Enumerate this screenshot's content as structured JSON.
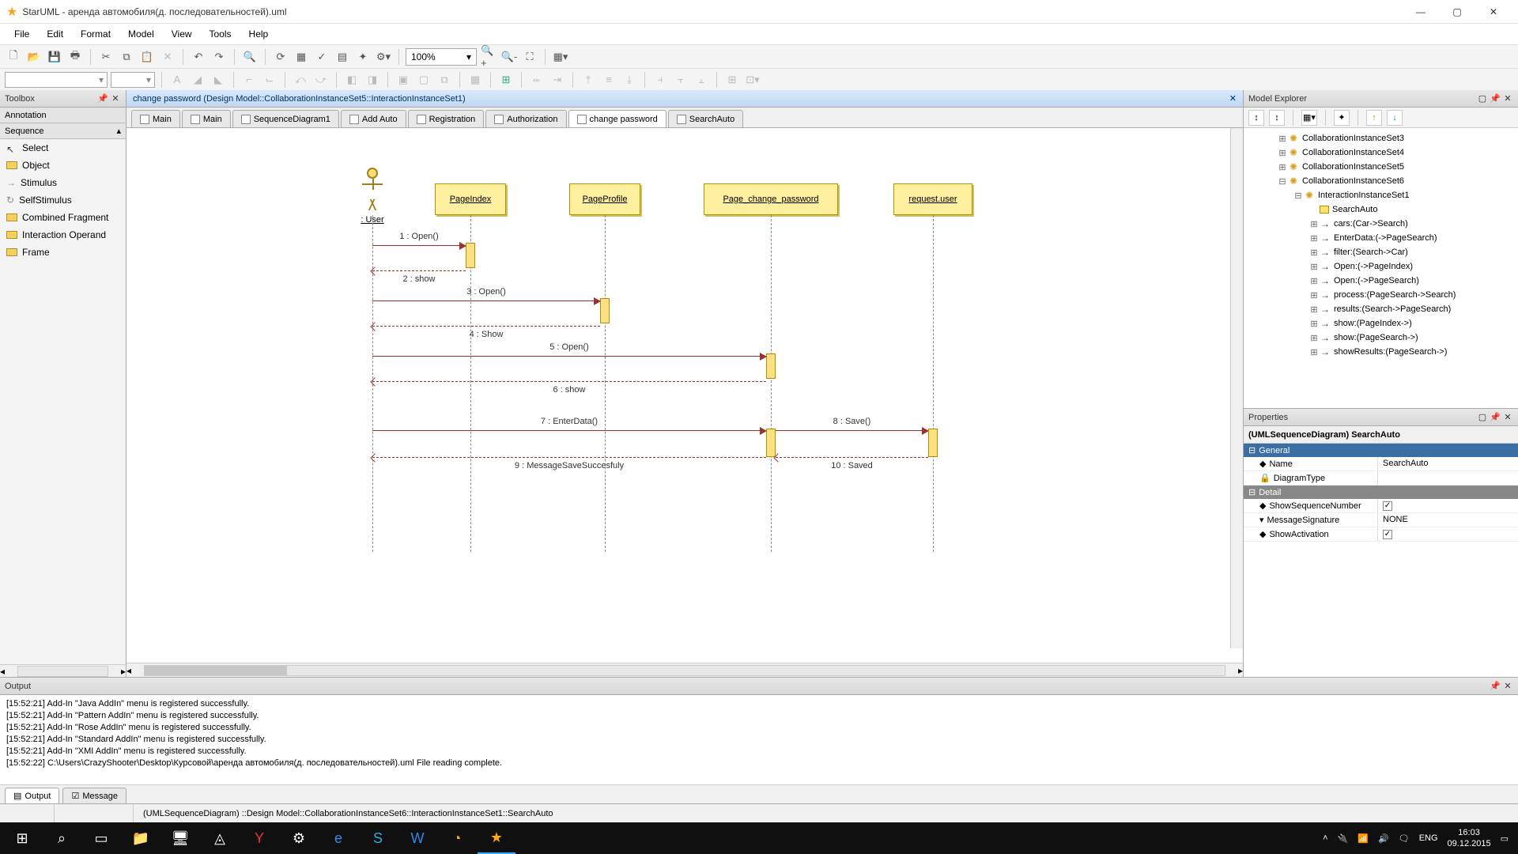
{
  "window": {
    "app": "StarUML",
    "title": "StarUML - аренда автомобиля(д. последовательностей).uml"
  },
  "menu": [
    "File",
    "Edit",
    "Format",
    "Model",
    "View",
    "Tools",
    "Help"
  ],
  "zoom": "100%",
  "toolbox": {
    "title": "Toolbox",
    "sections": {
      "annotation": "Annotation",
      "sequence": "Sequence"
    },
    "items": [
      "Select",
      "Object",
      "Stimulus",
      "SelfStimulus",
      "Combined Fragment",
      "Interaction Operand",
      "Frame"
    ]
  },
  "doc_path": "change password (Design Model::CollaborationInstanceSet5::InteractionInstanceSet1)",
  "tabs": [
    "Main",
    "Main",
    "SequenceDiagram1",
    "Add Auto",
    "Registration",
    "Authorization",
    "change password",
    "SearchAuto"
  ],
  "diagram": {
    "actor": ": User",
    "objects": {
      "pageindex": "PageIndex",
      "pageprofile": "PageProfile",
      "pagechange": "Page_change_password",
      "requestuser": "request.user"
    },
    "messages": {
      "m1": "1 : Open()",
      "m2": "2 : show",
      "m3": "3 : Open()",
      "m4": "4 : Show",
      "m5": "5 : Open()",
      "m6": "6 : show",
      "m7": "7 : EnterData()",
      "m8": "8 : Save()",
      "m9": "9 : MessageSaveSuccesfuly",
      "m10": "10 : Saved"
    }
  },
  "model_explorer": {
    "title": "Model Explorer",
    "nodes": {
      "cis3": "CollaborationInstanceSet3",
      "cis4": "CollaborationInstanceSet4",
      "cis5": "CollaborationInstanceSet5",
      "cis6": "CollaborationInstanceSet6",
      "iis1": "InteractionInstanceSet1",
      "searchauto": "SearchAuto",
      "cars": "cars:(Car->Search)",
      "enterdata": "EnterData:(->PageSearch)",
      "filter": "filter:(Search->Car)",
      "open1": "Open:(->PageIndex)",
      "open2": "Open:(->PageSearch)",
      "process": "process:(PageSearch->Search)",
      "results": "results:(Search->PageSearch)",
      "show1": "show:(PageIndex->)",
      "show2": "show:(PageSearch->)",
      "showresults": "showResults:(PageSearch->)"
    }
  },
  "properties": {
    "title": "Properties",
    "object_label": "(UMLSequenceDiagram) SearchAuto",
    "groups": {
      "general": "General",
      "detail": "Detail"
    },
    "rows": {
      "name_k": "Name",
      "name_v": "SearchAuto",
      "diagtype_k": "DiagramType",
      "diagtype_v": "",
      "showseq_k": "ShowSequenceNumber",
      "msgsig_k": "MessageSignature",
      "msgsig_v": "NONE",
      "showact_k": "ShowActivation"
    }
  },
  "output": {
    "title": "Output",
    "lines": [
      "[15:52:21]  Add-In \"Java AddIn\" menu is registered successfully.",
      "[15:52:21]  Add-In \"Pattern AddIn\" menu is registered successfully.",
      "[15:52:21]  Add-In \"Rose AddIn\" menu is registered successfully.",
      "[15:52:21]  Add-In \"Standard AddIn\" menu is registered successfully.",
      "[15:52:21]  Add-In \"XMI AddIn\" menu is registered successfully.",
      "[15:52:22]  C:\\Users\\CrazyShooter\\Desktop\\Курсовой\\аренда автомобиля(д. последовательностей).uml File reading complete."
    ],
    "tabs": {
      "output": "Output",
      "message": "Message"
    }
  },
  "statusbar": "(UMLSequenceDiagram) ::Design Model::CollaborationInstanceSet6::InteractionInstanceSet1::SearchAuto",
  "taskbar": {
    "lang": "ENG",
    "time": "16:03",
    "date": "09.12.2015"
  }
}
